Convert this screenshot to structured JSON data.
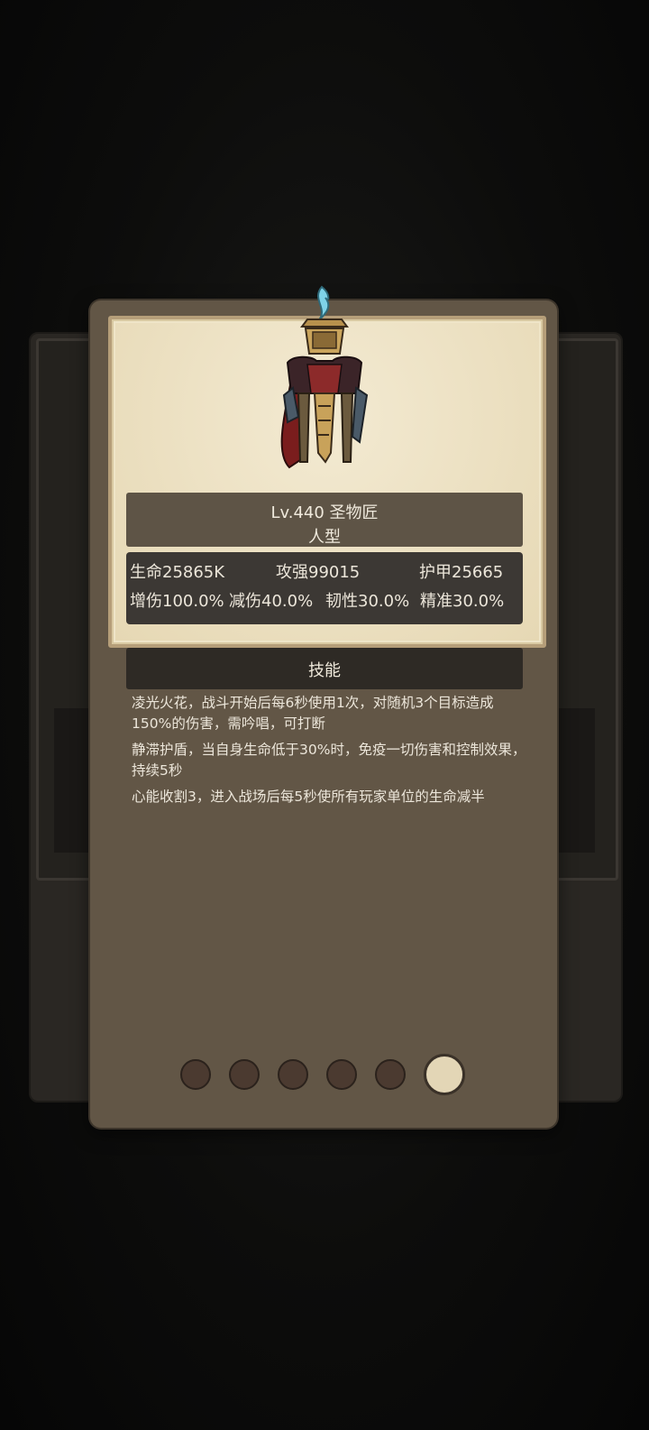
{
  "monster": {
    "level_name": "Lv.440 圣物匠",
    "type": "人型"
  },
  "stats": {
    "hp": "生命25865K",
    "attack": "攻强99015",
    "armor": "护甲25665",
    "dmg_boost": "增伤100.0%",
    "dmg_reduce": "减伤40.0%",
    "tenacity": "韧性30.0%",
    "accuracy": "精准30.0%"
  },
  "skills": {
    "header": "技能",
    "items": [
      "凌光火花，战斗开始后每6秒使用1次，对随机3个目标造成150%的伤害，需吟唱，可打断",
      "静滞护盾，当自身生命低于30%时，免疫一切伤害和控制效果，持续5秒",
      "心能收割3，进入战场后每5秒使所有玩家单位的生命减半"
    ]
  },
  "pager": {
    "total": 6,
    "active_index": 5
  },
  "colors": {
    "card": "#625646",
    "parchment": "#efe5c8",
    "stats_bg": "#3c3834",
    "active_dot": "#e3d6b6",
    "inactive_dot": "#4b3a30"
  }
}
